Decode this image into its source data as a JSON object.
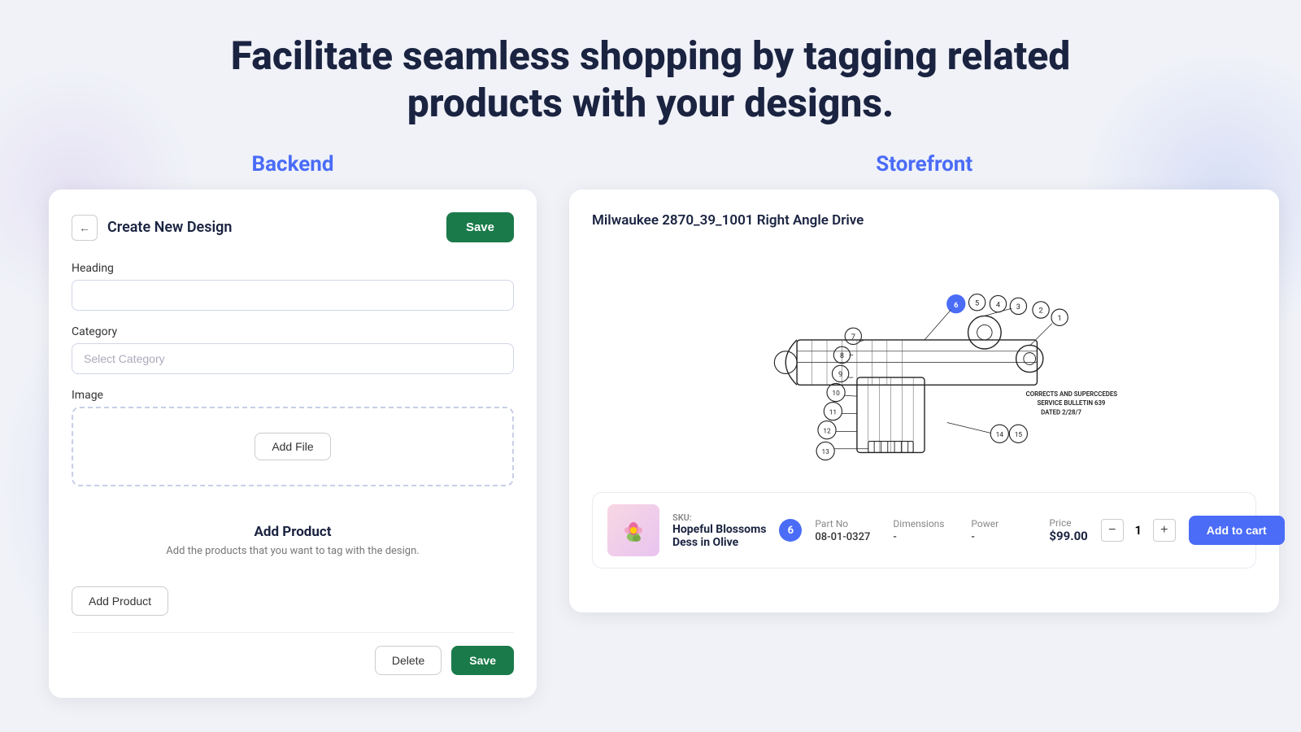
{
  "page": {
    "heading_line1": "Facilitate seamless shopping by tagging related",
    "heading_line2": "products with your designs."
  },
  "backend": {
    "section_label": "Backend",
    "card": {
      "title": "Create New Design",
      "save_button": "Save",
      "back_button": "←",
      "heading_label": "Heading",
      "heading_placeholder": "",
      "category_label": "Category",
      "category_placeholder": "Select Category",
      "image_label": "Image",
      "add_file_button": "Add File",
      "add_product_title": "Add Product",
      "add_product_desc": "Add the products that you want to tag with the design.",
      "add_product_button": "Add Product",
      "delete_button": "Delete",
      "save_bottom_button": "Save"
    }
  },
  "storefront": {
    "section_label": "Storefront",
    "product_title": "Milwaukee 2870_39_1001 Right Angle Drive",
    "diagram_note_line1": "CORRECTS AND SUPERCCEDES",
    "diagram_note_line2": "SERVICE BULLETIN 639",
    "diagram_note_line3": "DATED 2/28/7",
    "product_row": {
      "sku_label": "SKU:",
      "product_name_line1": "Hopeful Blossoms",
      "product_name_line2": "Dess in Olive",
      "badge": "6",
      "part_no_label": "Part No",
      "part_no_value": "08-01-0327",
      "dimensions_label": "Dimensions",
      "dimensions_value": "-",
      "power_label": "Power",
      "power_value": "-",
      "price_label": "Price",
      "price_value": "$99.00",
      "qty_minus": "−",
      "qty_value": "1",
      "qty_plus": "+",
      "add_to_cart_button": "Add to cart"
    }
  }
}
